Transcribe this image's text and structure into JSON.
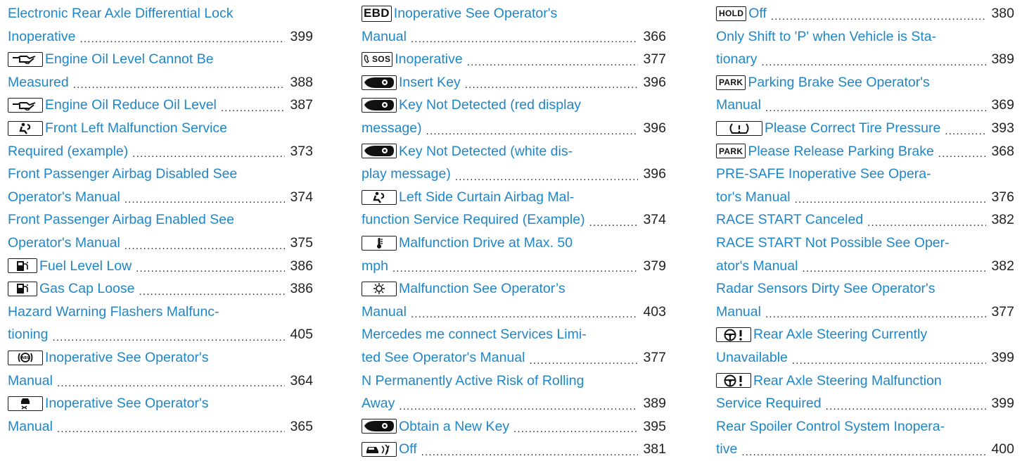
{
  "columns": [
    {
      "lines": [
        {
          "icon": "",
          "text": "Electronic Rear Axle Differential Lock",
          "page": ""
        },
        {
          "icon": "",
          "text": "Inoperative",
          "page": "399"
        },
        {
          "icon": "oil-level-icon",
          "text": "Engine Oil Level Cannot Be",
          "page": ""
        },
        {
          "icon": "",
          "text": "Measured",
          "page": "388"
        },
        {
          "icon": "oil-level-icon",
          "text": "Engine Oil Reduce Oil Level",
          "page": "387"
        },
        {
          "icon": "airbag-icon",
          "text": "Front Left Malfunction Service",
          "page": ""
        },
        {
          "icon": "",
          "text": "Required (example)",
          "page": "373"
        },
        {
          "icon": "",
          "text": "Front Passenger Airbag Disabled See",
          "page": ""
        },
        {
          "icon": "",
          "text": "Operator's Manual",
          "page": "374"
        },
        {
          "icon": "",
          "text": "Front Passenger Airbag Enabled See",
          "page": ""
        },
        {
          "icon": "",
          "text": "Operator's Manual",
          "page": "375"
        },
        {
          "icon": "fuel-pump-icon",
          "text": "Fuel Level Low",
          "page": "386"
        },
        {
          "icon": "fuel-pump-icon",
          "text": "Gas Cap Loose",
          "page": "386"
        },
        {
          "icon": "",
          "text": "Hazard Warning Flashers Malfunc-",
          "page": ""
        },
        {
          "icon": "",
          "text": "tioning",
          "page": "405"
        },
        {
          "icon": "abs-icon",
          "text": "Inoperative See Operator's",
          "page": ""
        },
        {
          "icon": "",
          "text": "Manual",
          "page": "364"
        },
        {
          "icon": "skid-car-icon",
          "text": "Inoperative See Operator's",
          "page": ""
        },
        {
          "icon": "",
          "text": "Manual",
          "page": "365"
        }
      ]
    },
    {
      "lines": [
        {
          "icon": "ebd-icon",
          "icon_text": "EBD",
          "text": "Inoperative See Operator's",
          "page": ""
        },
        {
          "icon": "",
          "text": "Manual",
          "page": "366"
        },
        {
          "icon": "sos-icon",
          "icon_text": "SOS",
          "text": "Inoperative",
          "page": "377"
        },
        {
          "icon": "key-icon",
          "text": "Insert Key",
          "page": "396"
        },
        {
          "icon": "key-icon",
          "text": "Key Not Detected   (red display",
          "page": ""
        },
        {
          "icon": "",
          "text": "message)",
          "page": "396"
        },
        {
          "icon": "key-icon",
          "text": "Key Not Detected   (white dis-",
          "page": ""
        },
        {
          "icon": "",
          "text": "play message)",
          "page": "396"
        },
        {
          "icon": "airbag-icon",
          "text": "Left Side Curtain Airbag Mal-",
          "page": ""
        },
        {
          "icon": "",
          "text": "function Service Required (Example)",
          "page": "374"
        },
        {
          "icon": "coolant-icon",
          "text": "Malfunction Drive at Max. 50",
          "page": ""
        },
        {
          "icon": "",
          "text": "mph",
          "page": "379"
        },
        {
          "icon": "light-icon",
          "text": "Malfunction See Operator’s",
          "page": ""
        },
        {
          "icon": "",
          "text": "Manual",
          "page": "403"
        },
        {
          "icon": "",
          "text": "Mercedes me connect Services Limi-",
          "page": ""
        },
        {
          "icon": "",
          "text": "ted See Operator's Manual",
          "page": "377"
        },
        {
          "icon": "",
          "text": "N Permanently Active Risk of Rolling",
          "page": ""
        },
        {
          "icon": "",
          "text": "Away",
          "page": "389"
        },
        {
          "icon": "key-icon",
          "text": "Obtain a New Key",
          "page": "395"
        },
        {
          "icon": "car-sensor-icon",
          "text": "Off",
          "page": "381"
        }
      ]
    },
    {
      "lines": [
        {
          "icon": "hold-icon",
          "icon_text": "HOLD",
          "text": "Off",
          "page": "380"
        },
        {
          "icon": "",
          "text": "Only Shift to 'P' when Vehicle is Sta-",
          "page": ""
        },
        {
          "icon": "",
          "text": "tionary",
          "page": "389"
        },
        {
          "icon": "park-icon",
          "icon_text": "PARK",
          "text": "Parking Brake See Operator's",
          "page": ""
        },
        {
          "icon": "",
          "text": "Manual",
          "page": "369"
        },
        {
          "icon": "tire-pressure-icon",
          "text": "Please Correct Tire Pressure",
          "page": "393"
        },
        {
          "icon": "park-icon",
          "icon_text": "PARK",
          "text": "Please Release Parking Brake",
          "page": "368"
        },
        {
          "icon": "",
          "text": "PRE-SAFE Inoperative See Opera-",
          "page": ""
        },
        {
          "icon": "",
          "text": "tor's Manual",
          "page": "376"
        },
        {
          "icon": "",
          "text": "RACE START Canceled",
          "page": "382"
        },
        {
          "icon": "",
          "text": "RACE START Not Possible See Oper-",
          "page": ""
        },
        {
          "icon": "",
          "text": "ator's Manual",
          "page": "382"
        },
        {
          "icon": "",
          "text": "Radar Sensors Dirty See Operator's",
          "page": ""
        },
        {
          "icon": "",
          "text": "Manual",
          "page": "377"
        },
        {
          "icon": "steering-warning-icon",
          "text": "Rear Axle Steering Currently",
          "page": ""
        },
        {
          "icon": "",
          "text": "Unavailable",
          "page": "399"
        },
        {
          "icon": "steering-warning-icon",
          "text": "Rear Axle Steering Malfunction",
          "page": ""
        },
        {
          "icon": "",
          "text": "Service Required",
          "page": "399"
        },
        {
          "icon": "",
          "text": "Rear Spoiler Control System Inopera-",
          "page": ""
        },
        {
          "icon": "",
          "text": "tive",
          "page": "400"
        }
      ]
    }
  ]
}
